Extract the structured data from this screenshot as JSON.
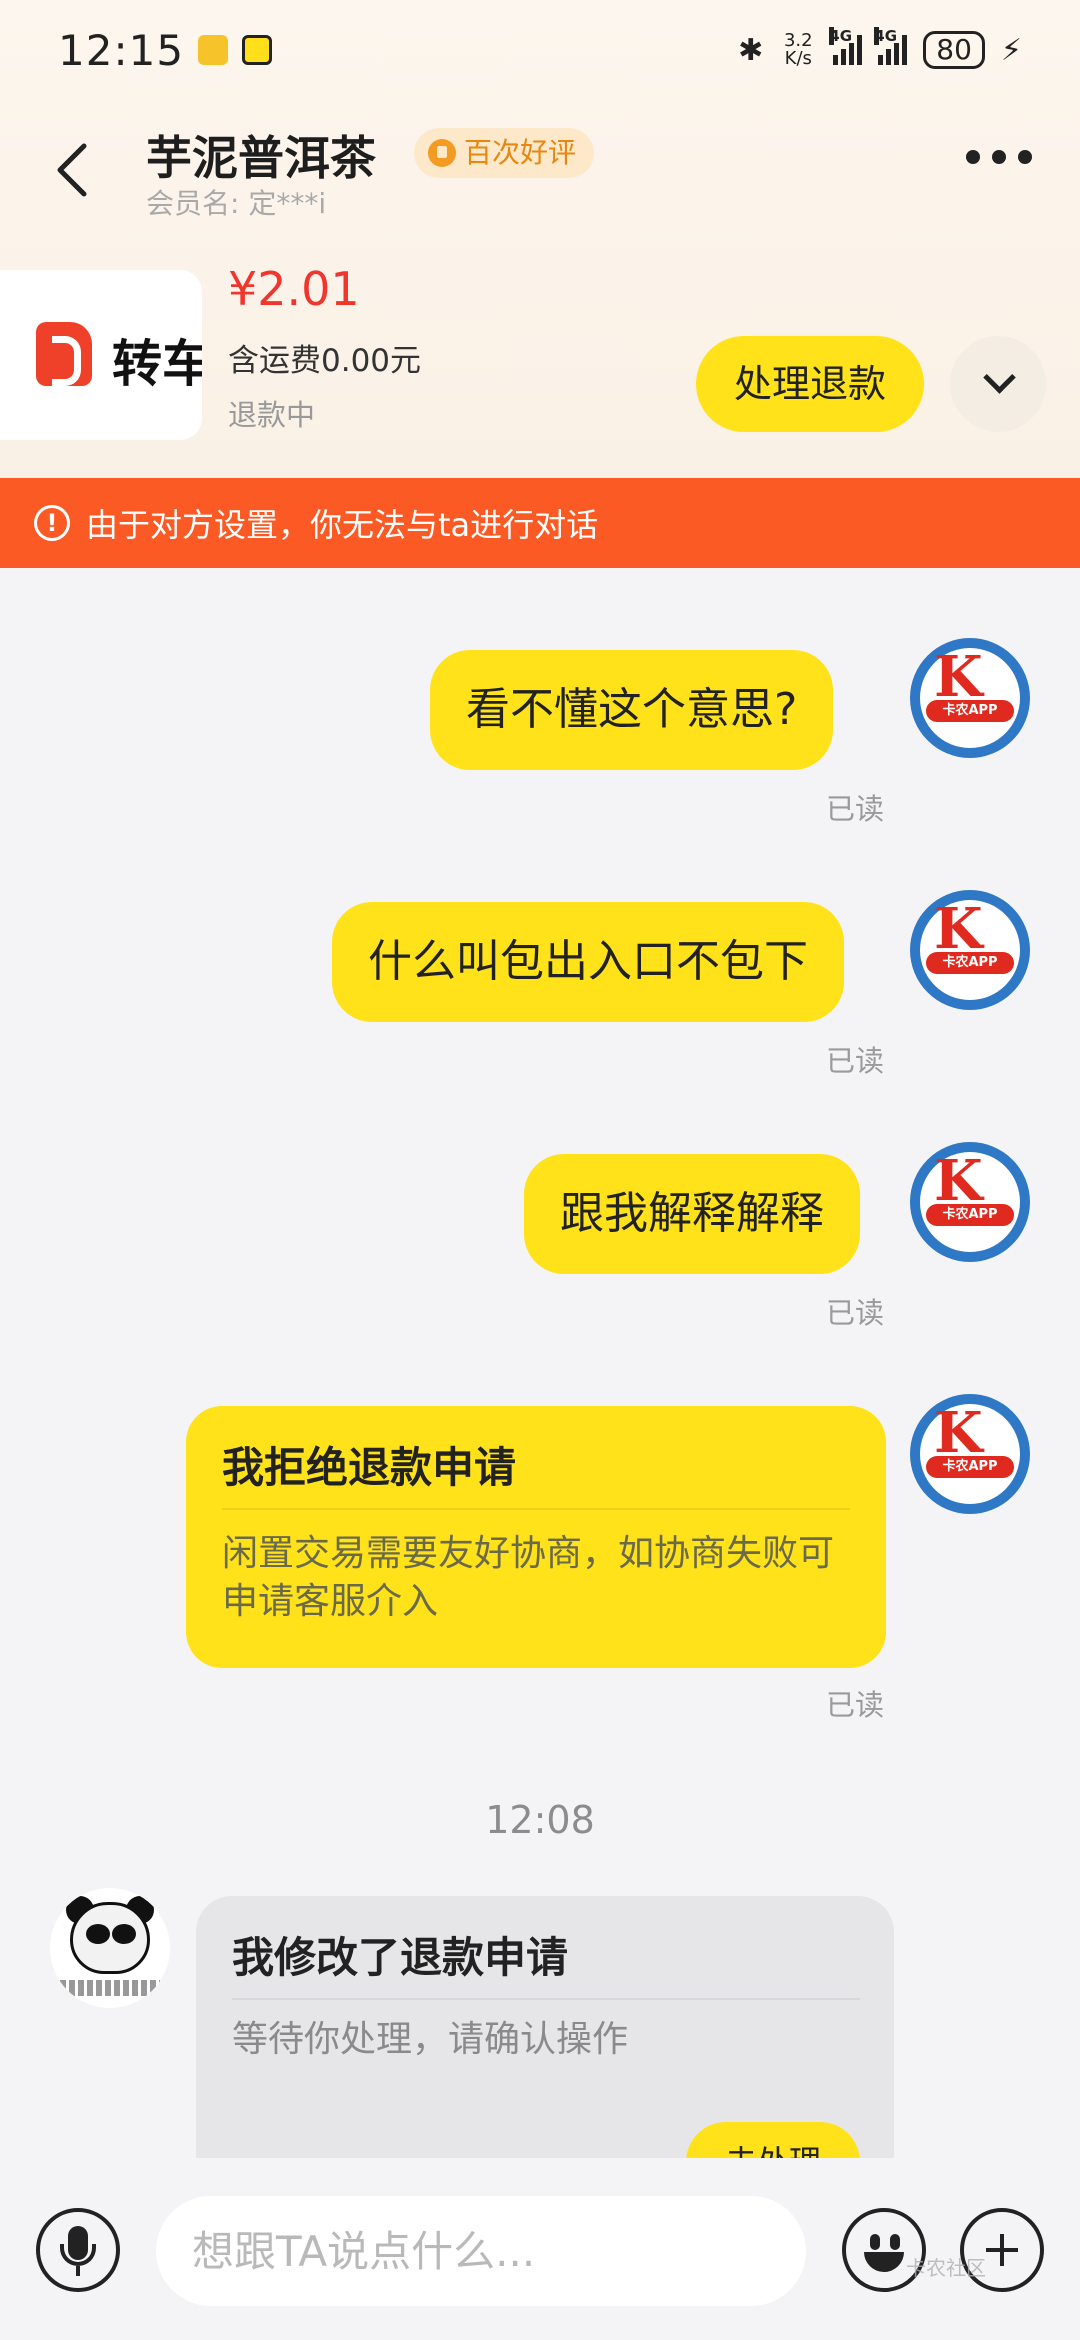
{
  "status_bar": {
    "time": "12:15",
    "net_speed_value": "3.2",
    "net_speed_unit": "K/s",
    "signal1_label": "4G",
    "signal2_label": "4G",
    "battery": "80"
  },
  "header": {
    "shop_name": "芋泥普洱茶",
    "badge": "百次好评",
    "member_label": "会员名: 定***i"
  },
  "product": {
    "thumb_text": "转车",
    "price": "¥2.01",
    "shipping": "含运费0.00元",
    "status": "退款中",
    "action_label": "处理退款"
  },
  "warning": {
    "text": "由于对方设置，你无法与ta进行对话"
  },
  "messages": [
    {
      "text": "看不懂这个意思?",
      "read": "已读"
    },
    {
      "text": "什么叫包出入口不包下",
      "read": "已读"
    },
    {
      "text": "跟我解释解释",
      "read": "已读"
    }
  ],
  "my_card": {
    "title": "我拒绝退款申请",
    "body": "闲置交易需要友好协商，如协商失败可申请客服介入",
    "read": "已读"
  },
  "avatar_me": {
    "letter": "K",
    "tag": "卡农APP"
  },
  "time_separator": "12:08",
  "their_card": {
    "title": "我修改了退款申请",
    "body": "等待你处理，请确认操作",
    "action_label": "去处理"
  },
  "input": {
    "placeholder": "想跟TA说点什么..."
  },
  "watermark": "卡农社区",
  "colors": {
    "accent_yellow": "#ffe21a",
    "warning_orange": "#fb5a24",
    "price_red": "#f0352d",
    "badge_orange": "#e8860f"
  }
}
